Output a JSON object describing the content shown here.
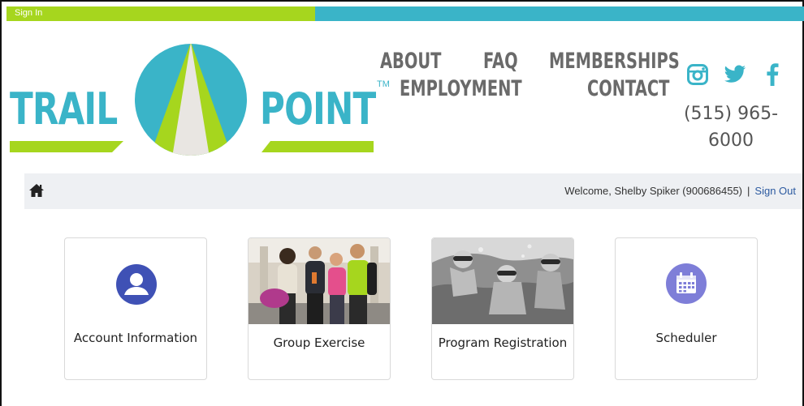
{
  "colors": {
    "brand_green": "#a6d61e",
    "brand_blue": "#3ab4c8",
    "nav_gray": "#6a6a6a",
    "link_blue": "#2c5aa0",
    "icon_indigo": "#3f51b5",
    "icon_purple": "#7e7ed8"
  },
  "topbar": {
    "signin_label": "Sign In"
  },
  "logo": {
    "word_left": "TRAIL",
    "word_right": "POINT",
    "trademark": "TM"
  },
  "nav": {
    "row1": [
      "ABOUT",
      "FAQ",
      "MEMBERSHIPS"
    ],
    "row2": [
      "EMPLOYMENT",
      "CONTACT"
    ]
  },
  "social": {
    "icons": [
      "instagram-icon",
      "twitter-icon",
      "facebook-icon"
    ]
  },
  "contact": {
    "phone_line1": "(515) 965-",
    "phone_line2": "6000"
  },
  "welcome_bar": {
    "welcome_text": "Welcome, Shelby Spiker  (900686455)",
    "separator": "|",
    "signout_label": "Sign Out",
    "home_icon": "home-icon"
  },
  "tiles": [
    {
      "label": "Account Information",
      "icon": "user-circle-icon"
    },
    {
      "label": "Group Exercise",
      "icon": "group-photo"
    },
    {
      "label": "Program Registration",
      "icon": "swimming-photo"
    },
    {
      "label": "Scheduler",
      "icon": "calendar-icon"
    }
  ]
}
